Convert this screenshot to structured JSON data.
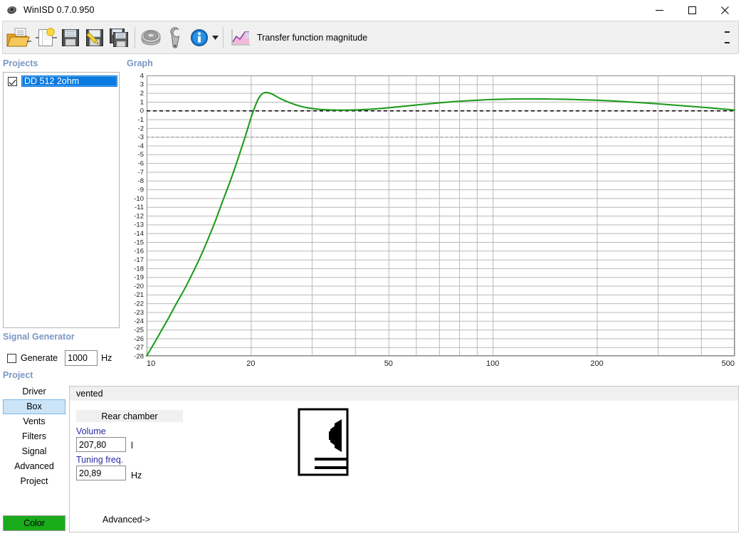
{
  "window": {
    "title": "WinISD 0.7.0.950",
    "icon": "speaker-icon",
    "minimize": "–",
    "maximize": "☐",
    "close": "✕"
  },
  "toolbar": {
    "items": [
      {
        "name": "open-project-icon",
        "label": "Open"
      },
      {
        "name": "new-project-icon",
        "label": "New"
      },
      {
        "name": "save-icon",
        "label": "Save"
      },
      {
        "name": "edit-save-icon",
        "label": "Save As"
      },
      {
        "name": "save-all-icon",
        "label": "Save All"
      },
      {
        "name": "driver-database-icon",
        "label": "Driver database"
      },
      {
        "name": "tools-icon",
        "label": "Tools"
      },
      {
        "name": "info-icon",
        "label": "Info"
      }
    ],
    "dropdown_caret": "▾",
    "graph_icon": "chart-icon",
    "graph_label": "Transfer function magnitude"
  },
  "projects": {
    "caption": "Projects",
    "items": [
      {
        "label": "DD 512 2ohm",
        "checked": true,
        "selected": true
      }
    ]
  },
  "signal_generator": {
    "caption": "Signal Generator",
    "generate_label": "Generate",
    "generate_checked": false,
    "frequency_value": "1000",
    "frequency_unit": "Hz"
  },
  "project_nav": {
    "caption": "Project",
    "items": [
      {
        "label": "Driver",
        "active": false
      },
      {
        "label": "Box",
        "active": true
      },
      {
        "label": "Vents",
        "active": false
      },
      {
        "label": "Filters",
        "active": false
      },
      {
        "label": "Signal",
        "active": false
      },
      {
        "label": "Advanced",
        "active": false
      },
      {
        "label": "Project",
        "active": false
      }
    ],
    "color_button": "Color"
  },
  "graph": {
    "caption": "Graph"
  },
  "box_panel": {
    "alignment": "vented",
    "chamber_tab": "Rear chamber",
    "volume_label": "Volume",
    "volume_value": "207,80",
    "volume_unit": "l",
    "tuning_label": "Tuning freq.",
    "tuning_value": "20,89",
    "tuning_unit": "Hz",
    "advanced_link": "Advanced->",
    "diagram": "vented-box-diagram"
  },
  "chart_data": {
    "type": "line",
    "title": "Transfer function magnitude",
    "xlabel": "",
    "ylabel": "",
    "xscale": "log",
    "xlim": [
      10,
      500
    ],
    "ylim": [
      -28,
      4
    ],
    "xticks": [
      10,
      20,
      50,
      100,
      200,
      500
    ],
    "yticks": [
      4,
      3,
      2,
      1,
      0,
      -1,
      -2,
      -3,
      -4,
      -5,
      -6,
      -7,
      -8,
      -9,
      -10,
      -11,
      -12,
      -13,
      -14,
      -15,
      -16,
      -17,
      -18,
      -19,
      -20,
      -21,
      -22,
      -23,
      -24,
      -25,
      -26,
      -27,
      -28
    ],
    "grid": true,
    "legend": "none",
    "reference_lines": [
      {
        "y": 0,
        "style": "dashed",
        "color": "#000000"
      },
      {
        "y": -3,
        "style": "dashed",
        "color": "#888888"
      }
    ],
    "series": [
      {
        "name": "DD 512 2ohm",
        "color": "#1d9c1d",
        "x": [
          10,
          10.5,
          11,
          11.6,
          12.2,
          12.9,
          13.6,
          14.3,
          15,
          15.8,
          16.6,
          17.5,
          18.4,
          19.3,
          20,
          20.5,
          21,
          21.5,
          22,
          22.8,
          23.6,
          24.5,
          25.5,
          26.5,
          27.5,
          29,
          30.5,
          32,
          34,
          36,
          38,
          41,
          44,
          48,
          52,
          57,
          62,
          68,
          75,
          82,
          90,
          100,
          110,
          122,
          135,
          150,
          165,
          182,
          200,
          225,
          250,
          280,
          310,
          345,
          380,
          420,
          460,
          500
        ],
        "y": [
          -28.0,
          -26.6,
          -25.2,
          -23.6,
          -22.0,
          -20.3,
          -18.5,
          -16.7,
          -14.8,
          -12.6,
          -10.3,
          -7.9,
          -5.4,
          -2.9,
          -0.9,
          0.3,
          1.3,
          1.85,
          2.05,
          1.95,
          1.65,
          1.3,
          1.0,
          0.75,
          0.55,
          0.33,
          0.2,
          0.12,
          0.07,
          0.05,
          0.05,
          0.08,
          0.14,
          0.25,
          0.38,
          0.53,
          0.68,
          0.83,
          0.97,
          1.08,
          1.17,
          1.26,
          1.3,
          1.32,
          1.32,
          1.3,
          1.27,
          1.22,
          1.17,
          1.08,
          0.97,
          0.85,
          0.72,
          0.58,
          0.45,
          0.32,
          0.18,
          0.05
        ]
      }
    ]
  }
}
